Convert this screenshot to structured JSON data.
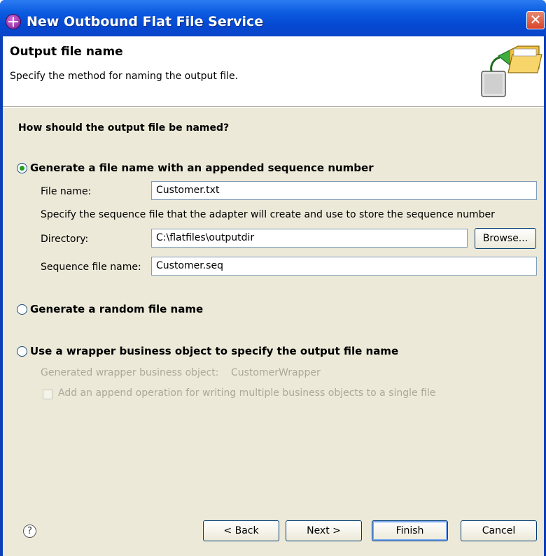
{
  "window": {
    "title": "New Outbound Flat File Service",
    "close_symbol": "✕"
  },
  "header": {
    "title": "Output file name",
    "description": "Specify the method for naming the output file.",
    "icon": "folder-wizard-icon"
  },
  "question": "How should the output file be named?",
  "option_sequence": {
    "label": "Generate a file name with an appended sequence number",
    "selected": true,
    "file_name_label": "File name:",
    "file_name_value": "Customer.txt",
    "hint": "Specify the sequence file that the adapter will create and use to store the sequence number",
    "directory_label": "Directory:",
    "directory_value": "C:\\flatfiles\\outputdir",
    "browse_label": "Browse...",
    "sequence_label": "Sequence file name:",
    "sequence_value": "Customer.seq"
  },
  "option_random": {
    "label": "Generate a random file name",
    "selected": false
  },
  "option_wrapper": {
    "label": "Use a wrapper business object to specify the output file name",
    "selected": false,
    "generated_label": "Generated wrapper business object:",
    "generated_value": "CustomerWrapper",
    "append_label": "Add an append operation for writing multiple business objects to a single file",
    "append_checked": false
  },
  "footer": {
    "help_symbol": "?",
    "back_label": "< Back",
    "next_label": "Next >",
    "finish_label": "Finish",
    "cancel_label": "Cancel"
  },
  "colors": {
    "titlebar": "#0a55dc",
    "dialog_background": "#ece9d8",
    "radio_selected": "#21a121",
    "disabled_text": "#aca899"
  }
}
